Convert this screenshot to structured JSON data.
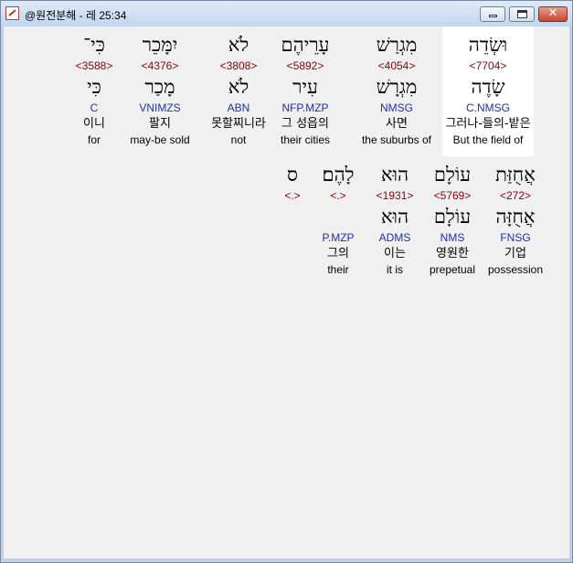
{
  "window": {
    "title": "@원전분해 - 레 25:34",
    "close_glyph": "✕"
  },
  "row1": [
    {
      "heb": "וּשְׂדֵה",
      "strong": "<7704>",
      "lemma": "שָׂדֶה",
      "parse": "C.NMSG",
      "kor": "그러나-들의-밭은",
      "eng": "But the field of"
    },
    {
      "heb": "מִגְרַשׁ",
      "strong": "<4054>",
      "lemma": "מִגְרָשׁ",
      "parse": "NMSG",
      "kor": "사면",
      "eng": "the suburbs of"
    },
    {
      "heb": "עָרֵיהֶם",
      "strong": "<5892>",
      "lemma": "עִיר",
      "parse": "NFP.MZP",
      "kor": "그 성읍의",
      "eng": "their cities"
    },
    {
      "heb": "לֹא",
      "strong": "<3808>",
      "lemma": "לֹא",
      "parse": "ABN",
      "kor": "못할찌니라",
      "eng": "not"
    },
    {
      "heb": "יִמָּכֵר",
      "strong": "<4376>",
      "lemma": "מָכַר",
      "parse": "VNIMZS",
      "kor": "팔지",
      "eng": "may-be sold"
    },
    {
      "heb": "כִּי־",
      "strong": "<3588>",
      "lemma": "כִּי",
      "parse": "C",
      "kor": "이니",
      "eng": "for"
    }
  ],
  "row2": [
    {
      "heb": "אֲחֻזַּת",
      "strong": "<272>",
      "lemma": "אֲחֻזָּה",
      "parse": "FNSG",
      "kor": "기업",
      "eng": "possession"
    },
    {
      "heb": "עוֹלָם",
      "strong": "<5769>",
      "lemma": "עוֹלָם",
      "parse": "NMS",
      "kor": "영원한",
      "eng": "prepetual"
    },
    {
      "heb": "הוּא",
      "strong": "<1931>",
      "lemma": "הוּא",
      "parse": "ADMS",
      "kor": "이는",
      "eng": "it is"
    },
    {
      "heb": "לָהֶם׃",
      "strong": "<.>",
      "lemma": "",
      "parse": "P.MZP",
      "kor": "그의",
      "eng": "their"
    },
    {
      "heb": "ס",
      "strong": "<.>",
      "lemma": "",
      "parse": "",
      "kor": "",
      "eng": ""
    }
  ]
}
